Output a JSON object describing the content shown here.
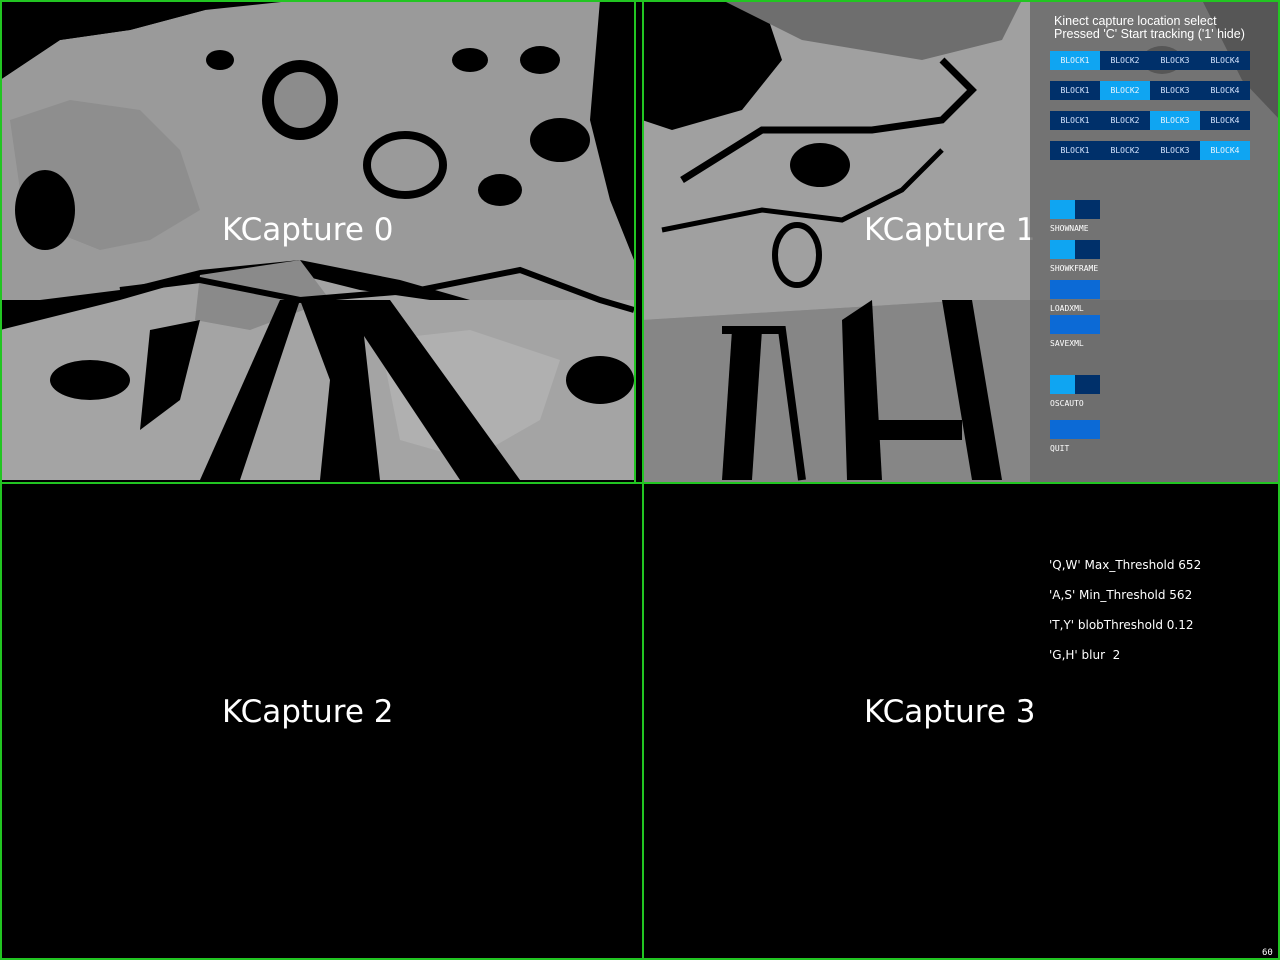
{
  "captures": [
    {
      "label": "KCapture 0"
    },
    {
      "label": "KCapture 1"
    },
    {
      "label": "KCapture 2"
    },
    {
      "label": "KCapture 3"
    }
  ],
  "panel": {
    "title_line1": "Kinect capture location select",
    "title_line2": "Pressed 'C' Start tracking ('1' hide)",
    "block_rows": [
      {
        "options": [
          "BLOCK1",
          "BLOCK2",
          "BLOCK3",
          "BLOCK4"
        ],
        "selected": "BLOCK1"
      },
      {
        "options": [
          "BLOCK1",
          "BLOCK2",
          "BLOCK3",
          "BLOCK4"
        ],
        "selected": "BLOCK2"
      },
      {
        "options": [
          "BLOCK1",
          "BLOCK2",
          "BLOCK3",
          "BLOCK4"
        ],
        "selected": "BLOCK3"
      },
      {
        "options": [
          "BLOCK1",
          "BLOCK2",
          "BLOCK3",
          "BLOCK4"
        ],
        "selected": "BLOCK4"
      }
    ],
    "controls": {
      "showname": "SHOWNAME",
      "showkframe": "SHOWKFRAME",
      "loadxml": "LOADXML",
      "savexml": "SAVEXML",
      "oscauto": "OSCAUTO",
      "quit": "QUIT"
    },
    "colors": {
      "active": "#0fa5f2",
      "inactive": "#00306a",
      "button": "#0c6ad6"
    }
  },
  "info": {
    "max_threshold": "'Q,W' Max_Threshold 652",
    "min_threshold": "'A,S' Min_Threshold 562",
    "blob_threshold": "'T,Y' blobThreshold 0.12",
    "blur": "'G,H' blur  2"
  },
  "fps": "60",
  "grid_color": "#22c522"
}
